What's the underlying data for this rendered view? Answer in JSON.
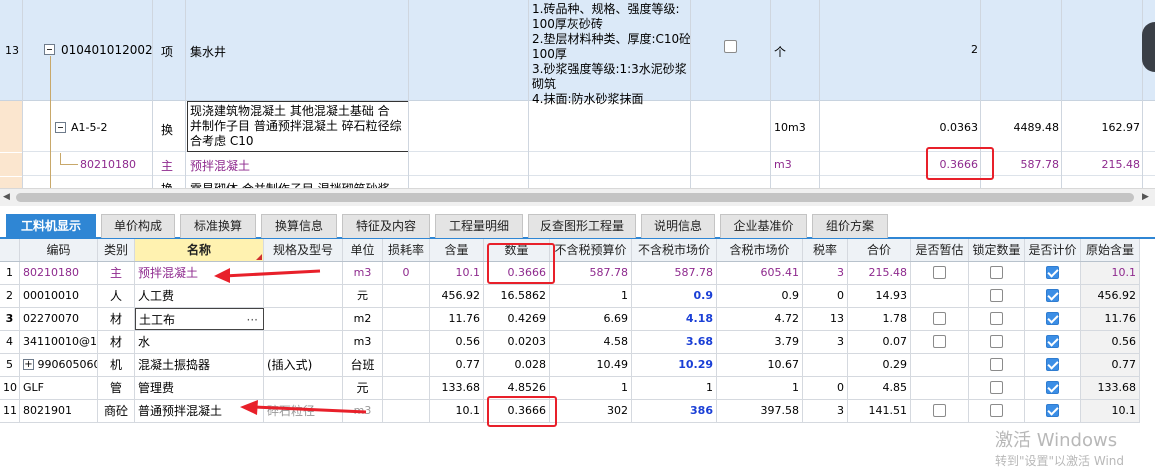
{
  "upper": {
    "row13": {
      "index": "13",
      "code": "010401012002",
      "type": "项",
      "name": "集水井",
      "features": [
        "1.砖品种、规格、强度等级:",
        "100厚灰砂砖",
        "2.垫层材料种类、厚度:C10砼",
        "100厚",
        "3.砂浆强度等级:1:3水泥砂浆",
        "砌筑",
        "4.抹面:防水砂浆抹面"
      ],
      "unit": "个",
      "qty": "2"
    },
    "rowA": {
      "code": "A1-5-2",
      "type": "换",
      "name": [
        "现浇建筑物混凝土 其他混凝土基础  合",
        "并制作子目 普通预拌混凝土 碎石粒径综",
        "合考虑 C10"
      ],
      "unit": "10m3",
      "qty": "0.0363",
      "price": "4489.48",
      "total": "162.97"
    },
    "rowB": {
      "code": "80210180",
      "type": "主",
      "name": "预拌混凝土",
      "unit": "m3",
      "qty": "0.3666",
      "price": "587.78",
      "total": "215.48"
    },
    "rowC": {
      "type": "换",
      "name": "零星砌体  合并制作子目 湿拌砌筑砂浆"
    }
  },
  "tabs": [
    "工料机显示",
    "单价构成",
    "标准换算",
    "换算信息",
    "特征及内容",
    "工程量明细",
    "反查图形工程量",
    "说明信息",
    "企业基准价",
    "组价方案"
  ],
  "lower": {
    "headers": [
      "",
      "编码",
      "类别",
      "名称",
      "规格及型号",
      "单位",
      "损耗率",
      "含量",
      "数量",
      "不含税预算价",
      "不含税市场价",
      "含税市场价",
      "税率",
      "合价",
      "是否暂估",
      "锁定数量",
      "是否计价",
      "原始含量"
    ],
    "rows": [
      {
        "idx": "1",
        "code": "80210180",
        "cat": "主",
        "name": "预拌混凝土",
        "spec": "",
        "unit": "m3",
        "loss": "0",
        "content": "10.1",
        "qty": "0.3666",
        "pre": "587.78",
        "market": "587.78",
        "tax_market": "605.41",
        "rate": "3",
        "total": "215.48",
        "est": true,
        "lock": true,
        "priced": true,
        "orig": "10.1"
      },
      {
        "idx": "2",
        "code": "00010010",
        "cat": "人",
        "name": "人工费",
        "spec": "",
        "unit": "元",
        "loss": "",
        "content": "456.92",
        "qty": "16.5862",
        "pre": "1",
        "market": "0.9",
        "tax_market": "0.9",
        "rate": "0",
        "total": "14.93",
        "est": false,
        "lock": true,
        "priced": true,
        "orig": "456.92"
      },
      {
        "idx": "3",
        "code": "02270070",
        "cat": "材",
        "name": "土工布",
        "spec": "",
        "unit": "m2",
        "loss": "",
        "content": "11.76",
        "qty": "0.4269",
        "pre": "6.69",
        "market": "4.18",
        "tax_market": "4.72",
        "rate": "13",
        "total": "1.78",
        "est": true,
        "lock": true,
        "priced": true,
        "orig": "11.76"
      },
      {
        "idx": "4",
        "code": "34110010@1",
        "cat": "材",
        "name": "水",
        "spec": "",
        "unit": "m3",
        "loss": "",
        "content": "0.56",
        "qty": "0.0203",
        "pre": "4.58",
        "market": "3.68",
        "tax_market": "3.79",
        "rate": "3",
        "total": "0.07",
        "est": true,
        "lock": true,
        "priced": true,
        "orig": "0.56"
      },
      {
        "idx": "5",
        "code": "990605060",
        "cat": "机",
        "name": "混凝土振捣器",
        "spec": "(插入式)",
        "unit": "台班",
        "loss": "",
        "content": "0.77",
        "qty": "0.028",
        "pre": "10.49",
        "market": "10.29",
        "tax_market": "10.67",
        "rate": "",
        "total": "0.29",
        "est": false,
        "lock": true,
        "priced": true,
        "orig": "0.77"
      },
      {
        "idx": "10",
        "code": "GLF",
        "cat": "管",
        "name": "管理费",
        "spec": "",
        "unit": "元",
        "loss": "",
        "content": "133.68",
        "qty": "4.8526",
        "pre": "1",
        "market": "1",
        "tax_market": "1",
        "rate": "0",
        "total": "4.85",
        "est": false,
        "lock": true,
        "priced": true,
        "orig": "133.68"
      },
      {
        "idx": "11",
        "code": "8021901",
        "cat": "商砼",
        "name": "普通预拌混凝土",
        "spec": "碎石粒径",
        "unit": "m3",
        "loss": "",
        "content": "10.1",
        "qty": "0.3666",
        "pre": "302",
        "market": "386",
        "tax_market": "397.58",
        "rate": "3",
        "total": "141.51",
        "est": true,
        "lock": true,
        "priced": true,
        "orig": "10.1"
      }
    ]
  },
  "colors": {
    "accent": "#2f86d4",
    "highlight": "#e8202a",
    "selected_row": "#dbe9f8",
    "main_material": "#8e2a8e",
    "market_price": "#1a3fd6"
  },
  "watermark": {
    "line1": "激活 Windows",
    "line2": "转到\"设置\"以激活 Wind"
  }
}
